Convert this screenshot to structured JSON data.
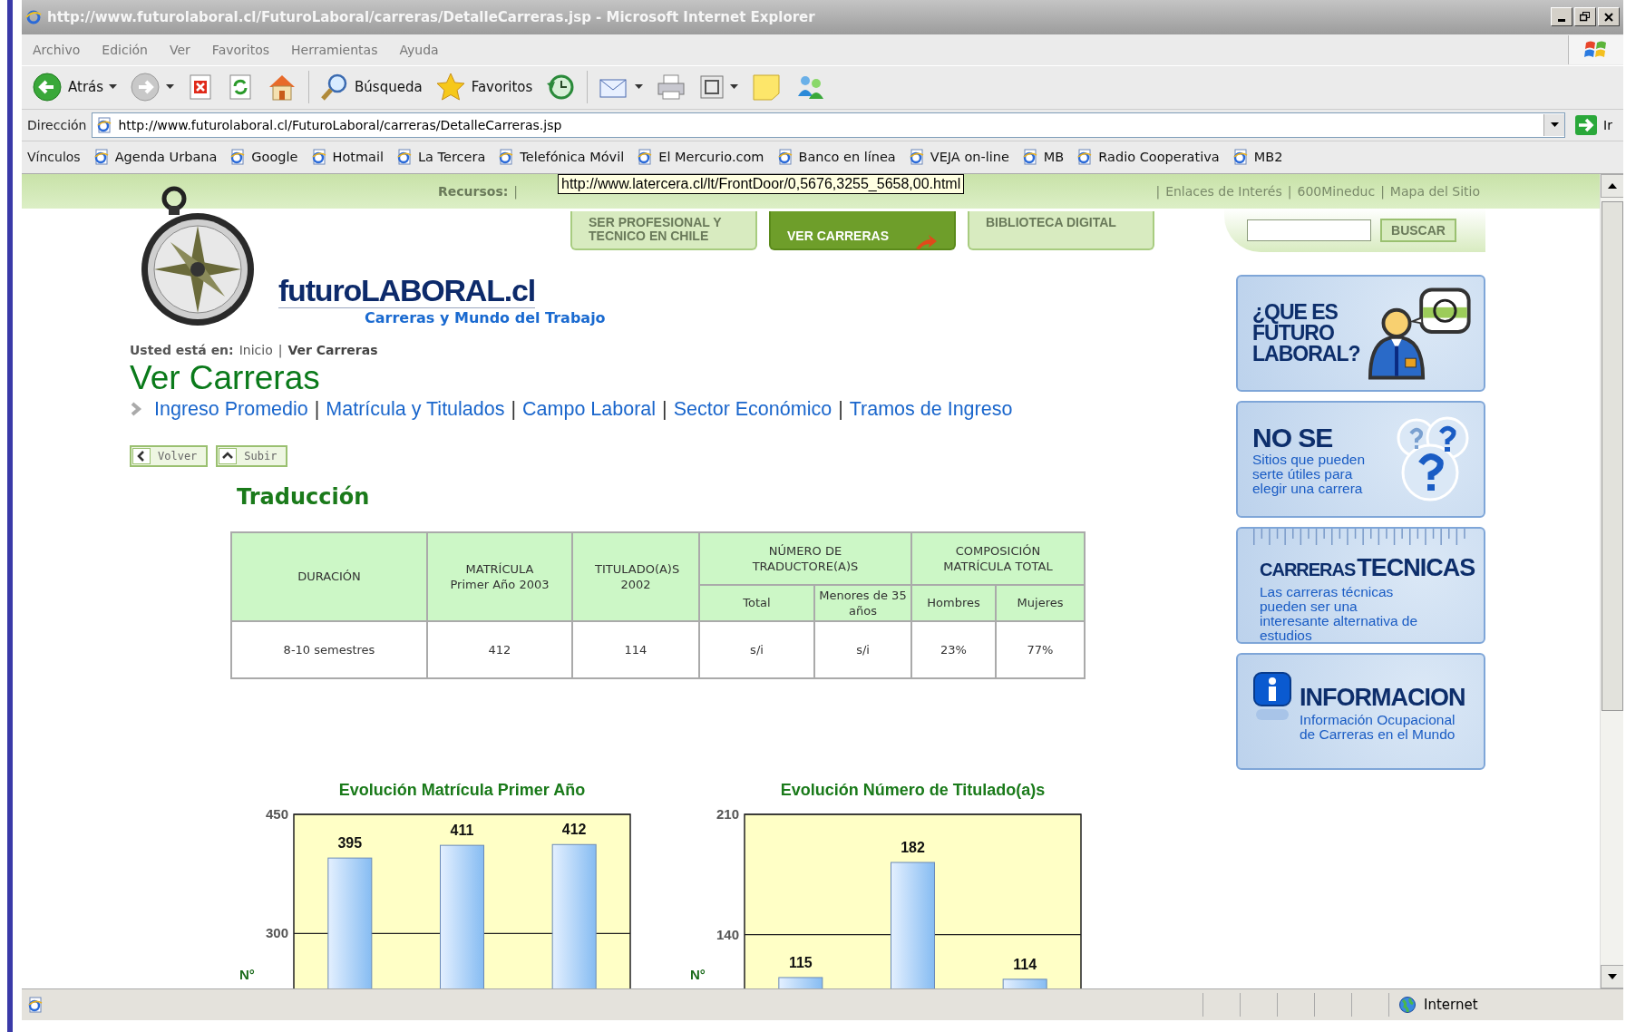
{
  "window": {
    "title": "http://www.futurolaboral.cl/FuturoLaboral/carreras/DetalleCarreras.jsp - Microsoft Internet Explorer"
  },
  "menu": [
    "Archivo",
    "Edición",
    "Ver",
    "Favoritos",
    "Herramientas",
    "Ayuda"
  ],
  "toolbar": [
    {
      "kind": "back",
      "label": "Atrás",
      "dropdown": true
    },
    {
      "kind": "forward",
      "dropdown": true
    },
    {
      "kind": "stop",
      "dropdown": false
    },
    {
      "kind": "refresh",
      "dropdown": false
    },
    {
      "kind": "home",
      "dropdown": false
    },
    {
      "kind": "search",
      "label": "Búsqueda",
      "dropdown": false
    },
    {
      "kind": "favorites",
      "label": "Favoritos",
      "dropdown": false
    },
    {
      "kind": "history",
      "dropdown": false
    },
    {
      "kind": "mail",
      "dropdown": true
    },
    {
      "kind": "print",
      "dropdown": false
    },
    {
      "kind": "edit",
      "dropdown": true
    },
    {
      "kind": "note",
      "dropdown": false
    },
    {
      "kind": "messenger",
      "dropdown": false
    }
  ],
  "address_bar": {
    "label": "Dirección",
    "url": "http://www.futurolaboral.cl/FuturoLaboral/carreras/DetalleCarreras.jsp",
    "go": "Ir"
  },
  "links_bar": {
    "label": "Vínculos",
    "links": [
      "Agenda Urbana",
      "Google",
      "Hotmail",
      "La Tercera",
      "Telefónica Móvil",
      "El Mercurio.com",
      "Banco en línea",
      "VEJA on-line",
      "MB",
      "Radio Cooperativa",
      "MB2"
    ]
  },
  "page": {
    "resources": {
      "label": "Recursos:",
      "separator": "|",
      "links": [
        "Enlaces de Interés",
        "600Mineduc",
        "Mapa del Sitio"
      ]
    },
    "tooltip": "http://www.latercera.cl/lt/FrontDoor/0,5676,3255_5658,00.html",
    "nav_tabs": [
      {
        "label": "SER PROFESIONAL Y TECNICO EN CHILE",
        "selected": false
      },
      {
        "label": "VER CARRERAS",
        "selected": true
      },
      {
        "label": "BIBLIOTECA DIGITAL",
        "selected": false
      }
    ],
    "search": {
      "button": "BUSCAR"
    },
    "logo": {
      "name": "futuroLABORAL.cl",
      "tagline": "Carreras y Mundo del Trabajo"
    },
    "breadcrumb": {
      "label": "Usted está en:",
      "separator": "|",
      "items": [
        "Inicio",
        "Ver Carreras"
      ]
    },
    "title": "Ver Carreras",
    "section_links": {
      "separator": "|",
      "links": [
        "Ingreso Promedio",
        "Matrícula y Titulados",
        "Campo Laboral",
        "Sector Económico",
        "Tramos de Ingreso"
      ]
    },
    "buttons": [
      {
        "kind": "back",
        "label": "Volver"
      },
      {
        "kind": "up",
        "label": "Subir"
      }
    ],
    "career": "Traducción",
    "table": {
      "header_rows": [
        [
          {
            "label": "DURACIÓN",
            "rowspan": 2
          },
          {
            "label": "MATRÍCULA Primer Año 2003",
            "rowspan": 2
          },
          {
            "label": "TITULADO(A)S 2002",
            "rowspan": 2
          },
          {
            "label": "NÚMERO DE TRADUCTORE(A)S",
            "colspan": 2
          },
          {
            "label": "COMPOSICIÓN MATRÍCULA TOTAL",
            "colspan": 2
          }
        ],
        [
          {
            "label": "Total"
          },
          {
            "label": "Menores de 35 años"
          },
          {
            "label": "Hombres"
          },
          {
            "label": "Mujeres"
          }
        ]
      ],
      "rows": [
        [
          "8-10 semestres",
          "412",
          "114",
          "s/i",
          "s/i",
          "23%",
          "77%"
        ]
      ]
    },
    "charts": [
      {
        "chart_data": {
          "type": "bar",
          "title": "Evolución Matrícula Primer Año",
          "ylabel": "N°",
          "values": [
            395,
            411,
            412
          ],
          "ylim": [
            225,
            450
          ],
          "yticks": [
            300,
            450
          ],
          "data_labels": true
        }
      },
      {
        "chart_data": {
          "type": "bar",
          "title": "Evolución Número de Titulado(a)s",
          "ylabel": "N°",
          "values": [
            115,
            182,
            114
          ],
          "ylim": [
            106,
            210
          ],
          "yticks": [
            140,
            210
          ],
          "data_labels": true
        }
      }
    ],
    "cards": [
      {
        "kind": "about",
        "title": "¿QUE ES FUTURO LABORAL?"
      },
      {
        "kind": "unsure",
        "title": "NO SE",
        "text": "Sitios que pueden serte útiles para elegir una carrera"
      },
      {
        "kind": "technical",
        "prefix": "CARRERAS",
        "title": "TECNICAS",
        "text": "Las carreras técnicas pueden ser una interesante alternativa de estudios"
      },
      {
        "kind": "info",
        "title": "INFORMACION",
        "text": "Información Ocupacional de Carreras en el Mundo"
      }
    ]
  },
  "status_bar": {
    "zone": "Internet"
  }
}
